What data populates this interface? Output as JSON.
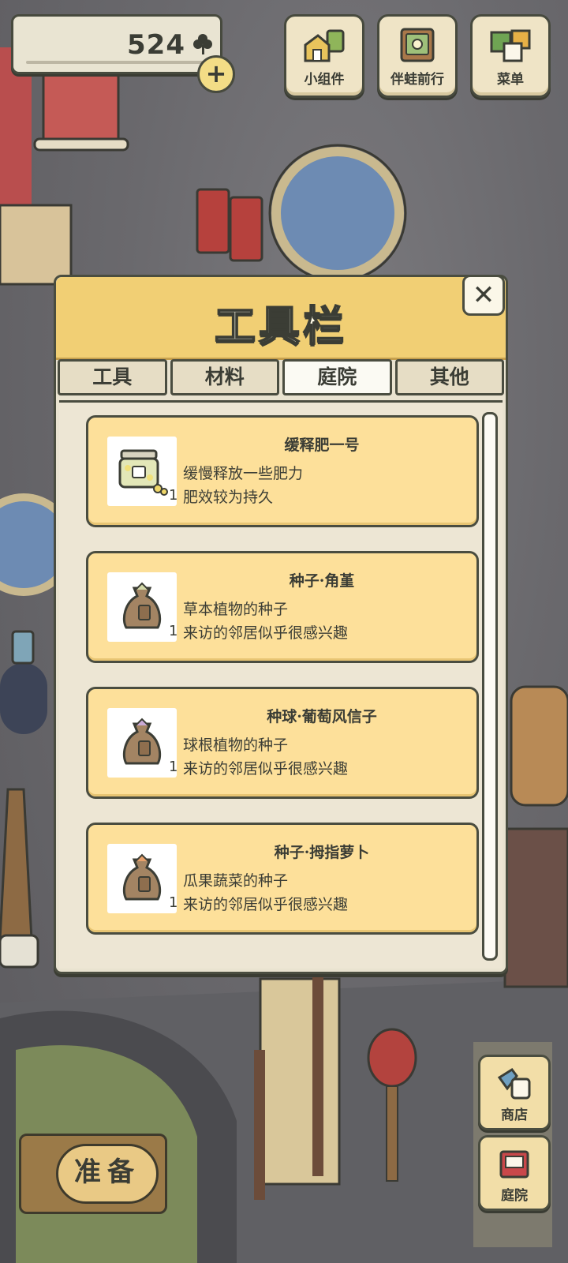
{
  "currency": {
    "value": "524",
    "icon": "clover-icon"
  },
  "top_buttons": [
    {
      "label": "小组件",
      "icon": "widget-icon"
    },
    {
      "label": "伴蛙前行",
      "icon": "album-icon"
    },
    {
      "label": "菜单",
      "icon": "menu-icon"
    }
  ],
  "modal": {
    "title": "工具栏",
    "close_label": "✕",
    "tabs": [
      {
        "label": "工具",
        "active": false
      },
      {
        "label": "材料",
        "active": false
      },
      {
        "label": "庭院",
        "active": true
      },
      {
        "label": "其他",
        "active": false
      }
    ],
    "items": [
      {
        "name": "缓释肥一号",
        "desc1": "缓慢释放一些肥力",
        "desc2": "肥效较为持久",
        "qty": "1",
        "icon": "fertilizer-jar-icon"
      },
      {
        "name": "种子·角堇",
        "desc1": "草本植物的种子",
        "desc2": "来访的邻居似乎很感兴趣",
        "qty": "1",
        "icon": "seed-bag-icon"
      },
      {
        "name": "种球·葡萄风信子",
        "desc1": "球根植物的种子",
        "desc2": "来访的邻居似乎很感兴趣",
        "qty": "1",
        "icon": "seed-bag-icon"
      },
      {
        "name": "种子·拇指萝卜",
        "desc1": "瓜果蔬菜的种子",
        "desc2": "来访的邻居似乎很感兴趣",
        "qty": "1",
        "icon": "seed-bag-icon"
      }
    ]
  },
  "bottom": {
    "ready_label": "准备",
    "shop_label": "商店",
    "yard_label": "庭院"
  }
}
